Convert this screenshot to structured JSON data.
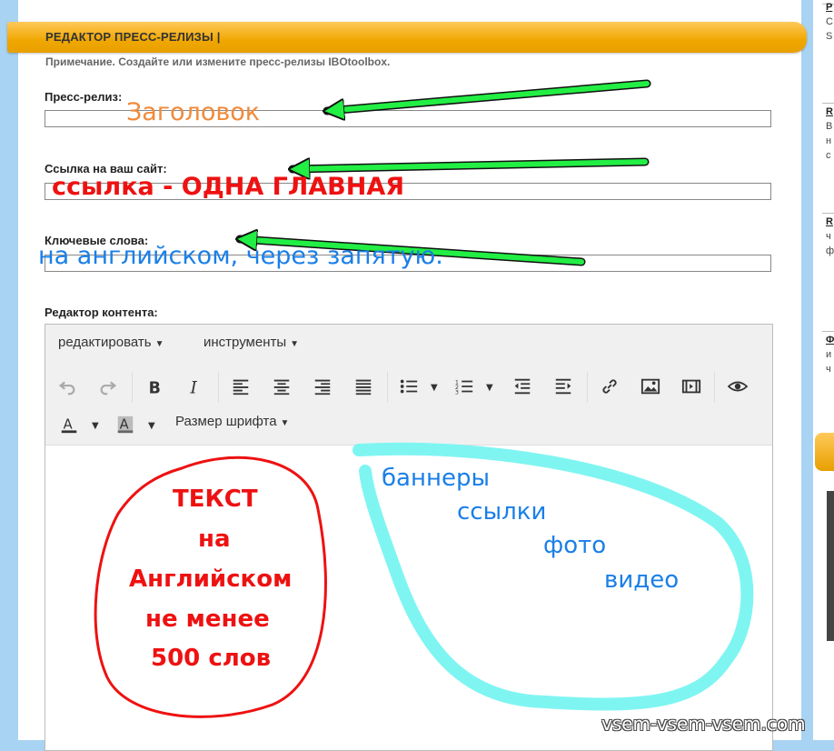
{
  "header": {
    "title": "РЕДАКТОР ПРЕСС-РЕЛИЗЫ |",
    "note": "Примечание. Создайте или измените пресс-релизы IBOtoolbox."
  },
  "form": {
    "press_release_label": "Пресс-релиз:",
    "press_release_value": "",
    "website_label": "Ссылка на ваш сайт:",
    "website_value": "",
    "keywords_label": "Ключевые слова:",
    "keywords_value": "",
    "content_label": "Редактор контента:"
  },
  "editor": {
    "menus": [
      "редактировать",
      "инструменты"
    ],
    "font_size_label": "Размер шрифта",
    "icons": [
      "undo-icon",
      "redo-icon",
      "bold-icon",
      "italic-icon",
      "align-left-icon",
      "align-center-icon",
      "align-right-icon",
      "align-justify-icon",
      "bullet-list-icon",
      "numbered-list-icon",
      "outdent-icon",
      "indent-icon",
      "link-icon",
      "image-icon",
      "video-icon",
      "preview-icon",
      "text-color-icon",
      "background-color-icon"
    ]
  },
  "annotations": {
    "title_hint": "Заголовок",
    "link_hint": "ссылка - ОДНА ГЛАВНАЯ",
    "keywords_hint": "на английском, через запятую.",
    "text_hint": [
      "ТЕКСТ",
      "на",
      "Английском",
      "не менее",
      "500 слов"
    ],
    "media_hint": [
      "баннеры",
      "ссылки",
      "фото",
      "видео"
    ],
    "colors": {
      "green": "#22ee44",
      "red": "#ee1111",
      "blue": "#1a7fe8",
      "cyan": "#7ff5f2",
      "orange": "#f08a3a"
    }
  },
  "sidebar": {
    "fragments": [
      "P",
      "C",
      "S",
      "R",
      "B",
      "н",
      "с",
      "R",
      "ч",
      "ф",
      "Ф",
      "и",
      "ч"
    ]
  },
  "watermark": "vsem-vsem-vsem.com"
}
